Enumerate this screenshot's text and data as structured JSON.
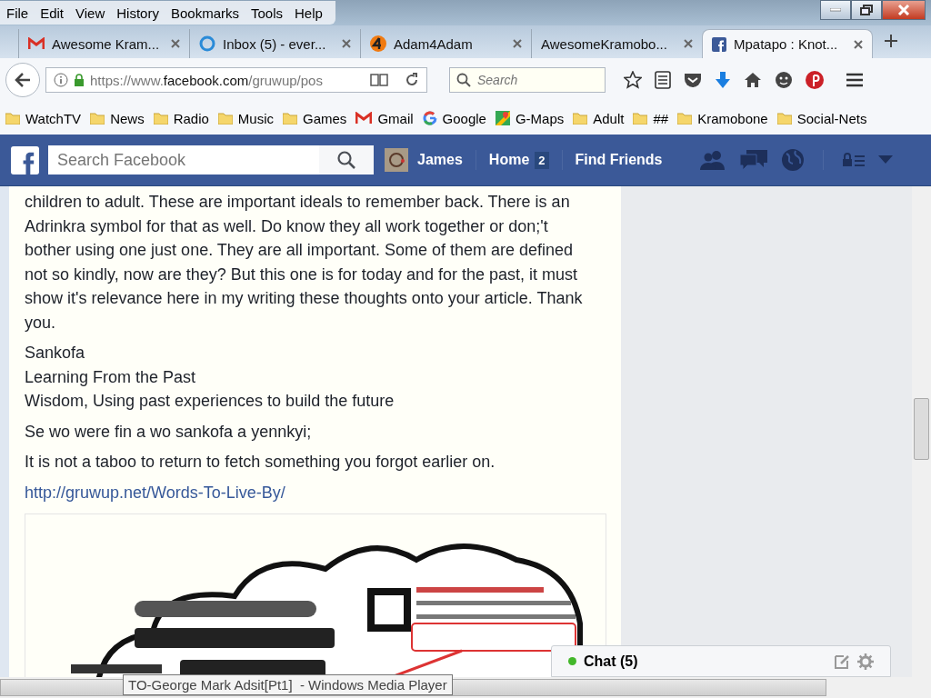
{
  "menu_bar": [
    "File",
    "Edit",
    "View",
    "History",
    "Bookmarks",
    "Tools",
    "Help"
  ],
  "tabs": [
    {
      "title": "Awesome Kram...",
      "kind": "mail",
      "selected": false
    },
    {
      "title": "Inbox (5) - ever...",
      "kind": "ring",
      "selected": false
    },
    {
      "title": "Adam4Adam",
      "kind": "number",
      "selected": false
    },
    {
      "title": "AwesomeKramobo...",
      "kind": "plain",
      "selected": false
    },
    {
      "title": "Mpatapo : Knot...",
      "kind": "facebook",
      "selected": true
    }
  ],
  "nav": {
    "url_start": "https://www.",
    "url_domain": "facebook.com",
    "url_end": "/gruwup/pos",
    "search_placeholder": "Search"
  },
  "bookmarks": [
    {
      "label": "WatchTV",
      "kind": "folder"
    },
    {
      "label": "News",
      "kind": "folder"
    },
    {
      "label": "Radio",
      "kind": "folder"
    },
    {
      "label": "Music",
      "kind": "folder"
    },
    {
      "label": "Games",
      "kind": "folder"
    },
    {
      "label": "Gmail",
      "kind": "mail"
    },
    {
      "label": "Google",
      "kind": "google"
    },
    {
      "label": "G-Maps",
      "kind": "map"
    },
    {
      "label": "Adult",
      "kind": "folder"
    },
    {
      "label": "##",
      "kind": "folder"
    },
    {
      "label": "Kramobone",
      "kind": "folder"
    },
    {
      "label": "Social-Nets",
      "kind": "folder"
    }
  ],
  "facebook": {
    "search_placeholder": "Search Facebook",
    "profile_name": "James",
    "home": "Home",
    "home_badge": "2",
    "find_friends": "Find Friends"
  },
  "post": {
    "paragraphs": [
      "children to adult. These are important ideals to remember back. There is an Adrinkra symbol for that as well. Do know they all work together or don;'t bother using one just one. They are all important. Some of them are defined not so kindly, now are they? But this one is for today and for the past, it must show it's relevance here in my writing these thoughts onto your article. Thank you."
    ],
    "lines": [
      "Sankofa",
      "Learning From the Past",
      "Wisdom, Using past experiences to build the future"
    ],
    "sayings": [
      "Se wo were fin a wo sankofa a yennkyi;",
      "It is not a taboo to return to fetch something you forgot earlier on."
    ],
    "link": "http://gruwup.net/Words-To-Live-By/",
    "image": {
      "kind": "picture"
    }
  },
  "chat": {
    "label": "Chat (5)",
    "online": true
  },
  "tooltip": "TO-George Mark Adsit[Pt1]  - Windows Media Player"
}
